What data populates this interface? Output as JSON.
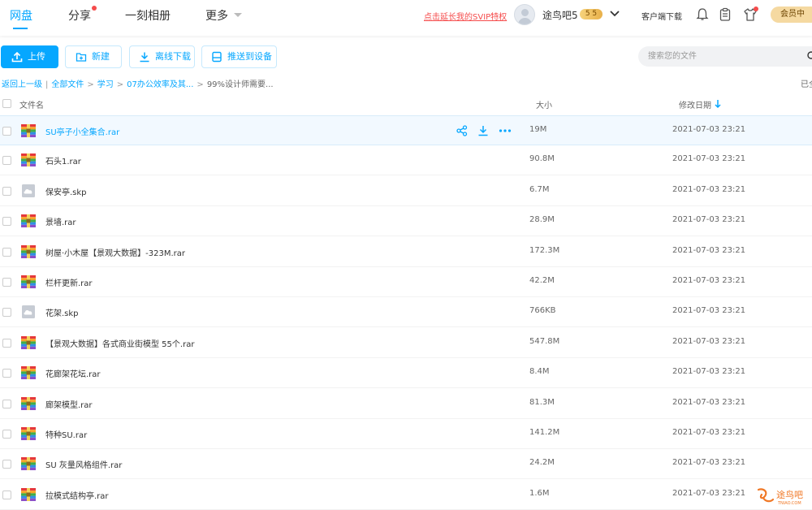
{
  "nav": {
    "items": [
      {
        "label": "网盘"
      },
      {
        "label": "分享"
      },
      {
        "label": "一刻相册"
      },
      {
        "label": "更多"
      }
    ],
    "svip_link": "点击延长我的SVIP特权",
    "username": "途鸟吧5",
    "vip_badge": "5 5",
    "client_download": "客户端下载",
    "member_button": "会员中"
  },
  "toolbar": {
    "upload": "上传",
    "new": "新建",
    "offline_download": "离线下载",
    "push_to_device": "推送到设备",
    "search_placeholder": "搜索您的文件"
  },
  "breadcrumb": {
    "back": "返回上一级",
    "items": [
      "全部文件",
      "学习",
      "07办公效率及其...",
      "99%设计师需要..."
    ],
    "loaded": "已全"
  },
  "table": {
    "columns": {
      "name": "文件名",
      "size": "大小",
      "date": "修改日期"
    },
    "rows": [
      {
        "name": "SU亭子小全集合.rar",
        "size": "19M",
        "date": "2021-07-03 23:21",
        "type": "rar"
      },
      {
        "name": "石头1.rar",
        "size": "90.8M",
        "date": "2021-07-03 23:21",
        "type": "rar"
      },
      {
        "name": "保安亭.skp",
        "size": "6.7M",
        "date": "2021-07-03 23:21",
        "type": "skp"
      },
      {
        "name": "景墙.rar",
        "size": "28.9M",
        "date": "2021-07-03 23:21",
        "type": "rar"
      },
      {
        "name": "树屋·小木屋【景观大数据】-323M.rar",
        "size": "172.3M",
        "date": "2021-07-03 23:21",
        "type": "rar"
      },
      {
        "name": "栏杆更新.rar",
        "size": "42.2M",
        "date": "2021-07-03 23:21",
        "type": "rar"
      },
      {
        "name": "花架.skp",
        "size": "766KB",
        "date": "2021-07-03 23:21",
        "type": "skp"
      },
      {
        "name": "【景观大数据】各式商业街模型 55个.rar",
        "size": "547.8M",
        "date": "2021-07-03 23:21",
        "type": "rar"
      },
      {
        "name": "花廊架花坛.rar",
        "size": "8.4M",
        "date": "2021-07-03 23:21",
        "type": "rar"
      },
      {
        "name": "廊架模型.rar",
        "size": "81.3M",
        "date": "2021-07-03 23:21",
        "type": "rar"
      },
      {
        "name": "特种SU.rar",
        "size": "141.2M",
        "date": "2021-07-03 23:21",
        "type": "rar"
      },
      {
        "name": "SU 灰量风格组件.rar",
        "size": "24.2M",
        "date": "2021-07-03 23:21",
        "type": "rar"
      },
      {
        "name": "拉模式结构亭.rar",
        "size": "1.6M",
        "date": "2021-07-03 23:21",
        "type": "rar"
      }
    ]
  },
  "watermark": {
    "text": "途鸟吧",
    "subtext": "TNIAO.COM"
  },
  "colors": {
    "accent": "#06a7ff",
    "alert": "#f54b4b",
    "vip_gold": "#f5d9a1"
  },
  "icons": {
    "upload": "upload-icon",
    "new": "new-folder-icon",
    "offline": "download-icon",
    "push": "device-icon",
    "search": "search-icon",
    "share": "share-icon",
    "download": "download-icon",
    "more": "more-icon",
    "bell": "bell-icon",
    "clipboard": "clipboard-icon",
    "shirt": "shirt-icon"
  }
}
